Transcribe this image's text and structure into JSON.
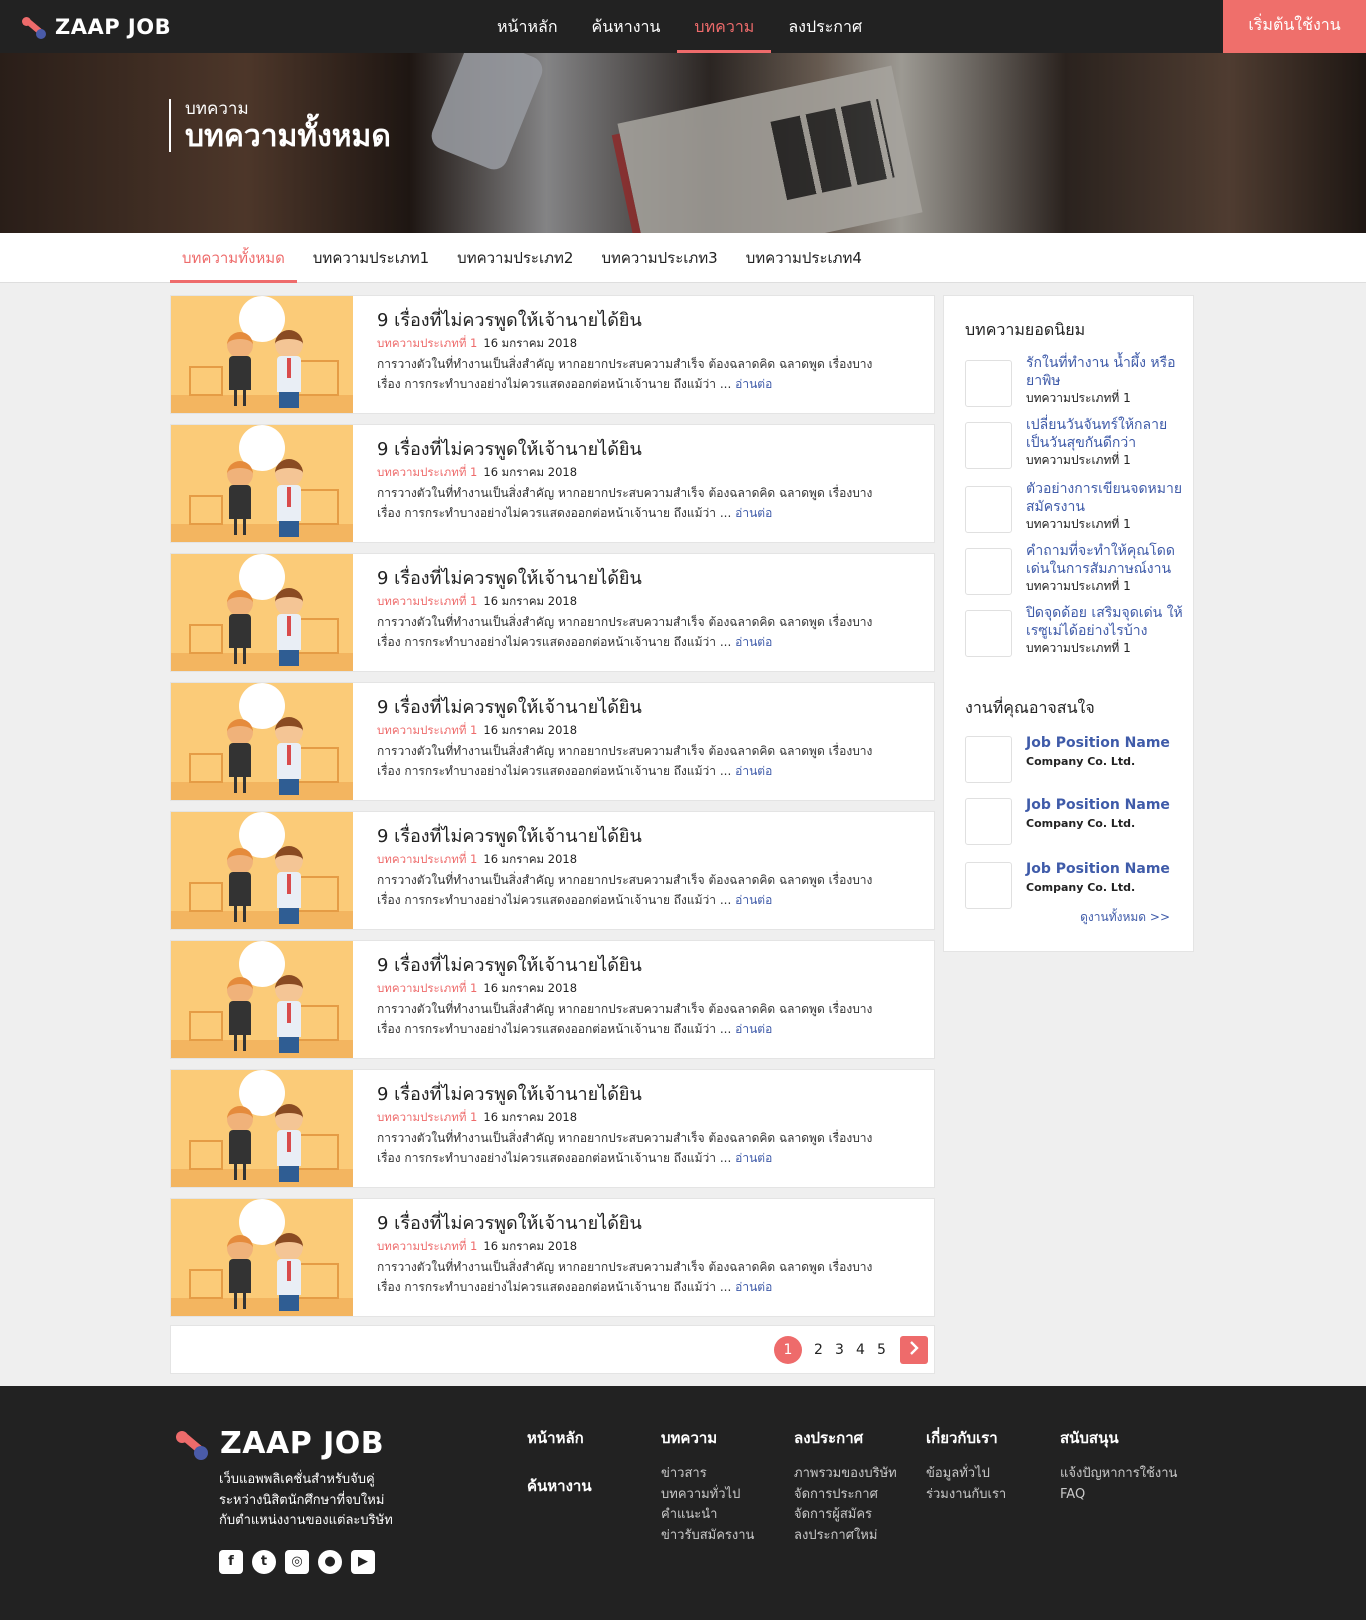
{
  "navbar": {
    "brand": "ZAAP JOB",
    "links": [
      "หน้าหลัก",
      "ค้นหางาน",
      "บทความ",
      "ลงประกาศ"
    ],
    "active_link": "บทความ",
    "cta": "เริ่มต้นใช้งาน"
  },
  "hero": {
    "subtitle": "บทความ",
    "title": "บทความทั้งหมด"
  },
  "subnav": {
    "items": [
      "บทความทั้งหมด",
      "บทความประเภท1",
      "บทความประเภท2",
      "บทความประเภท3",
      "บทความประเภท4"
    ],
    "active": "บทความทั้งหมด"
  },
  "articles": [
    {
      "title": "9 เรื่องที่ไม่ควรพูดให้เจ้านายได้ยิน",
      "category": "บทความประเภทที่ 1",
      "date": "16 มกราคม 2018",
      "excerpt": "การวางตัวในที่ทำงานเป็นสิ่งสำคัญ หากอยากประสบความสำเร็จ ต้องฉลาดคิด ฉลาดพูด เรื่องบางเรื่อง การกระทำบางอย่างไม่ควรแสดงออกต่อหน้าเจ้านาย ถึงแม้ว่า ...",
      "more": "อ่านต่อ"
    },
    {
      "title": "9 เรื่องที่ไม่ควรพูดให้เจ้านายได้ยิน",
      "category": "บทความประเภทที่ 1",
      "date": "16 มกราคม 2018",
      "excerpt": "การวางตัวในที่ทำงานเป็นสิ่งสำคัญ หากอยากประสบความสำเร็จ ต้องฉลาดคิด ฉลาดพูด เรื่องบางเรื่อง การกระทำบางอย่างไม่ควรแสดงออกต่อหน้าเจ้านาย ถึงแม้ว่า ...",
      "more": "อ่านต่อ"
    },
    {
      "title": "9 เรื่องที่ไม่ควรพูดให้เจ้านายได้ยิน",
      "category": "บทความประเภทที่ 1",
      "date": "16 มกราคม 2018",
      "excerpt": "การวางตัวในที่ทำงานเป็นสิ่งสำคัญ หากอยากประสบความสำเร็จ ต้องฉลาดคิด ฉลาดพูด เรื่องบางเรื่อง การกระทำบางอย่างไม่ควรแสดงออกต่อหน้าเจ้านาย ถึงแม้ว่า ...",
      "more": "อ่านต่อ"
    },
    {
      "title": "9 เรื่องที่ไม่ควรพูดให้เจ้านายได้ยิน",
      "category": "บทความประเภทที่ 1",
      "date": "16 มกราคม 2018",
      "excerpt": "การวางตัวในที่ทำงานเป็นสิ่งสำคัญ หากอยากประสบความสำเร็จ ต้องฉลาดคิด ฉลาดพูด เรื่องบางเรื่อง การกระทำบางอย่างไม่ควรแสดงออกต่อหน้าเจ้านาย ถึงแม้ว่า ...",
      "more": "อ่านต่อ"
    },
    {
      "title": "9 เรื่องที่ไม่ควรพูดให้เจ้านายได้ยิน",
      "category": "บทความประเภทที่ 1",
      "date": "16 มกราคม 2018",
      "excerpt": "การวางตัวในที่ทำงานเป็นสิ่งสำคัญ หากอยากประสบความสำเร็จ ต้องฉลาดคิด ฉลาดพูด เรื่องบางเรื่อง การกระทำบางอย่างไม่ควรแสดงออกต่อหน้าเจ้านาย ถึงแม้ว่า ...",
      "more": "อ่านต่อ"
    },
    {
      "title": "9 เรื่องที่ไม่ควรพูดให้เจ้านายได้ยิน",
      "category": "บทความประเภทที่ 1",
      "date": "16 มกราคม 2018",
      "excerpt": "การวางตัวในที่ทำงานเป็นสิ่งสำคัญ หากอยากประสบความสำเร็จ ต้องฉลาดคิด ฉลาดพูด เรื่องบางเรื่อง การกระทำบางอย่างไม่ควรแสดงออกต่อหน้าเจ้านาย ถึงแม้ว่า ...",
      "more": "อ่านต่อ"
    },
    {
      "title": "9 เรื่องที่ไม่ควรพูดให้เจ้านายได้ยิน",
      "category": "บทความประเภทที่ 1",
      "date": "16 มกราคม 2018",
      "excerpt": "การวางตัวในที่ทำงานเป็นสิ่งสำคัญ หากอยากประสบความสำเร็จ ต้องฉลาดคิด ฉลาดพูด เรื่องบางเรื่อง การกระทำบางอย่างไม่ควรแสดงออกต่อหน้าเจ้านาย ถึงแม้ว่า ...",
      "more": "อ่านต่อ"
    },
    {
      "title": "9 เรื่องที่ไม่ควรพูดให้เจ้านายได้ยิน",
      "category": "บทความประเภทที่ 1",
      "date": "16 มกราคม 2018",
      "excerpt": "การวางตัวในที่ทำงานเป็นสิ่งสำคัญ หากอยากประสบความสำเร็จ ต้องฉลาดคิด ฉลาดพูด เรื่องบางเรื่อง การกระทำบางอย่างไม่ควรแสดงออกต่อหน้าเจ้านาย ถึงแม้ว่า ...",
      "more": "อ่านต่อ"
    }
  ],
  "pagination": {
    "pages": [
      "1",
      "2",
      "3",
      "4",
      "5"
    ],
    "current": "1",
    "next_icon": "chevron-right-icon"
  },
  "sidebar": {
    "popular_heading": "บทความยอดนิยม",
    "popular": [
      {
        "title": "รักในที่ทำงาน น้ำผึ้ง หรือยาพิษ",
        "category": "บทความประเภทที่ 1"
      },
      {
        "title": "เปลี่ยนวันจันทร์ให้กลายเป็นวันสุขกันดีกว่า",
        "category": "บทความประเภทที่ 1"
      },
      {
        "title": "ตัวอย่างการเขียนจดหมายสมัครงาน",
        "category": "บทความประเภทที่ 1"
      },
      {
        "title": "คำถามที่จะทำให้คุณโดดเด่นในการสัมภาษณ์งาน",
        "category": "บทความประเภทที่ 1"
      },
      {
        "title": "ปิดจุดด้อย เสริมจุดเด่น ให้เรซูเม่ได้อย่างไรบ้าง",
        "category": "บทความประเภทที่ 1"
      }
    ],
    "jobs_heading": "งานที่คุณอาจสนใจ",
    "jobs": [
      {
        "title": "Job Position Name",
        "company": "Company Co. Ltd."
      },
      {
        "title": "Job Position Name",
        "company": "Company Co. Ltd."
      },
      {
        "title": "Job Position Name",
        "company": "Company Co. Ltd."
      }
    ],
    "see_all": "ดูงานทั้งหมด >>"
  },
  "footer": {
    "brand": "ZAAP JOB",
    "description": [
      "เว็บแอพพลิเคชั่นสำหรับจับคู่",
      "ระหว่างนิสิตนักศึกษาที่จบใหม่",
      "กับตำแหน่งงานของแต่ละบริษัท"
    ],
    "social": [
      "facebook-icon",
      "twitter-icon",
      "instagram-icon",
      "line-icon",
      "youtube-icon"
    ],
    "home_label": "หน้าหลัก",
    "search_label": "ค้นหางาน",
    "columns": [
      {
        "heading": "บทความ",
        "links": [
          "ข่าวสาร",
          "บทความทั่วไป",
          "คำแนะนำ",
          "ข่าวรับสมัครงาน"
        ]
      },
      {
        "heading": "ลงประกาศ",
        "links": [
          "ภาพรวมของบริษัท",
          "จัดการประกาศ",
          "จัดการผู้สมัคร",
          "ลงประกาศใหม่"
        ]
      },
      {
        "heading": "เกี่ยวกับเรา",
        "links": [
          "ข้อมูลทั่วไป",
          "ร่วมงานกับเรา"
        ]
      },
      {
        "heading": "สนับสนุน",
        "links": [
          "แจ้งปัญหาการใช้งาน",
          "FAQ"
        ]
      }
    ]
  },
  "colors": {
    "accent": "#ee6b6b",
    "link": "#3f5ba9",
    "dark": "#222222"
  }
}
